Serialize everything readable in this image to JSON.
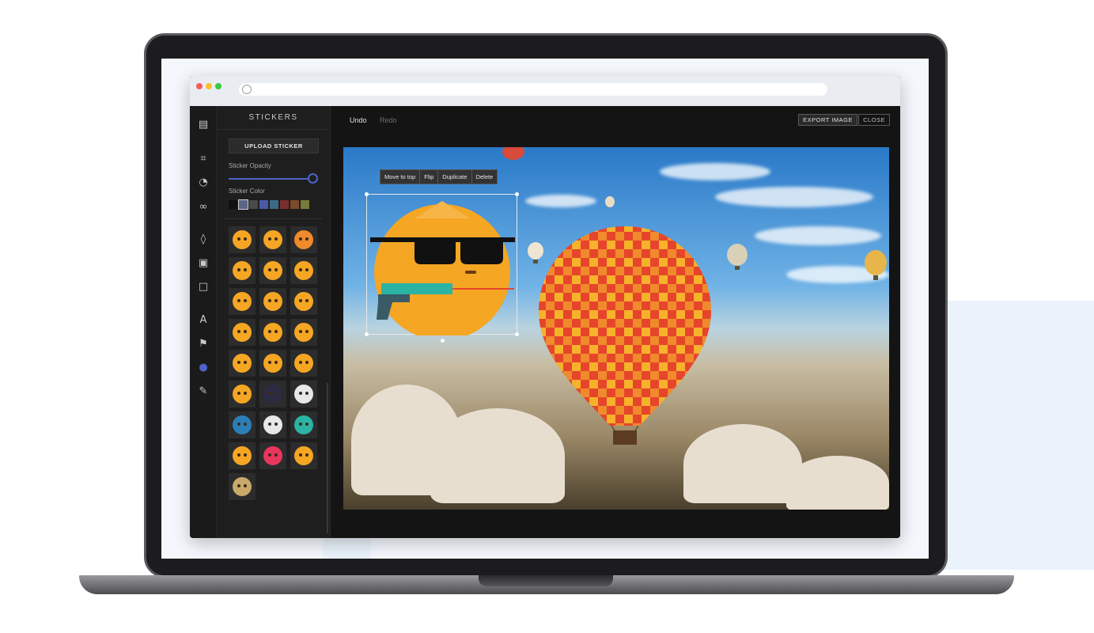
{
  "app": {
    "panel_title": "STICKERS",
    "upload_label": "UPLOAD STICKER",
    "opacity_label": "Sticker Opacity",
    "opacity_value": 0.96,
    "color_label": "Sticker Color",
    "swatch_colors": [
      "#111111",
      "#5a6487",
      "#4a4a4a",
      "#4b5aa7",
      "#3d6a86",
      "#7a2f2f",
      "#7b4a2a",
      "#7a7a3a"
    ],
    "selected_swatch": 1
  },
  "toolbar": {
    "undo": "Undo",
    "redo": "Redo",
    "export": "EXPORT IMAGE",
    "close": "CLOSE"
  },
  "context_menu": {
    "items": [
      "Move to top",
      "Flip",
      "Duplicate",
      "Delete"
    ]
  },
  "rail_icons": [
    "document-icon",
    "crop-icon",
    "adjust-icon",
    "filters-icon",
    "drop-icon",
    "frame-icon",
    "overlay-icon",
    "text-icon",
    "bookmark-icon",
    "sticker-icon",
    "brush-icon"
  ],
  "colors": {
    "accent": "#4e63c9",
    "panel_bg": "#1e1e1e",
    "sticker_orange": "#f5a623"
  },
  "sticker_count": 25
}
